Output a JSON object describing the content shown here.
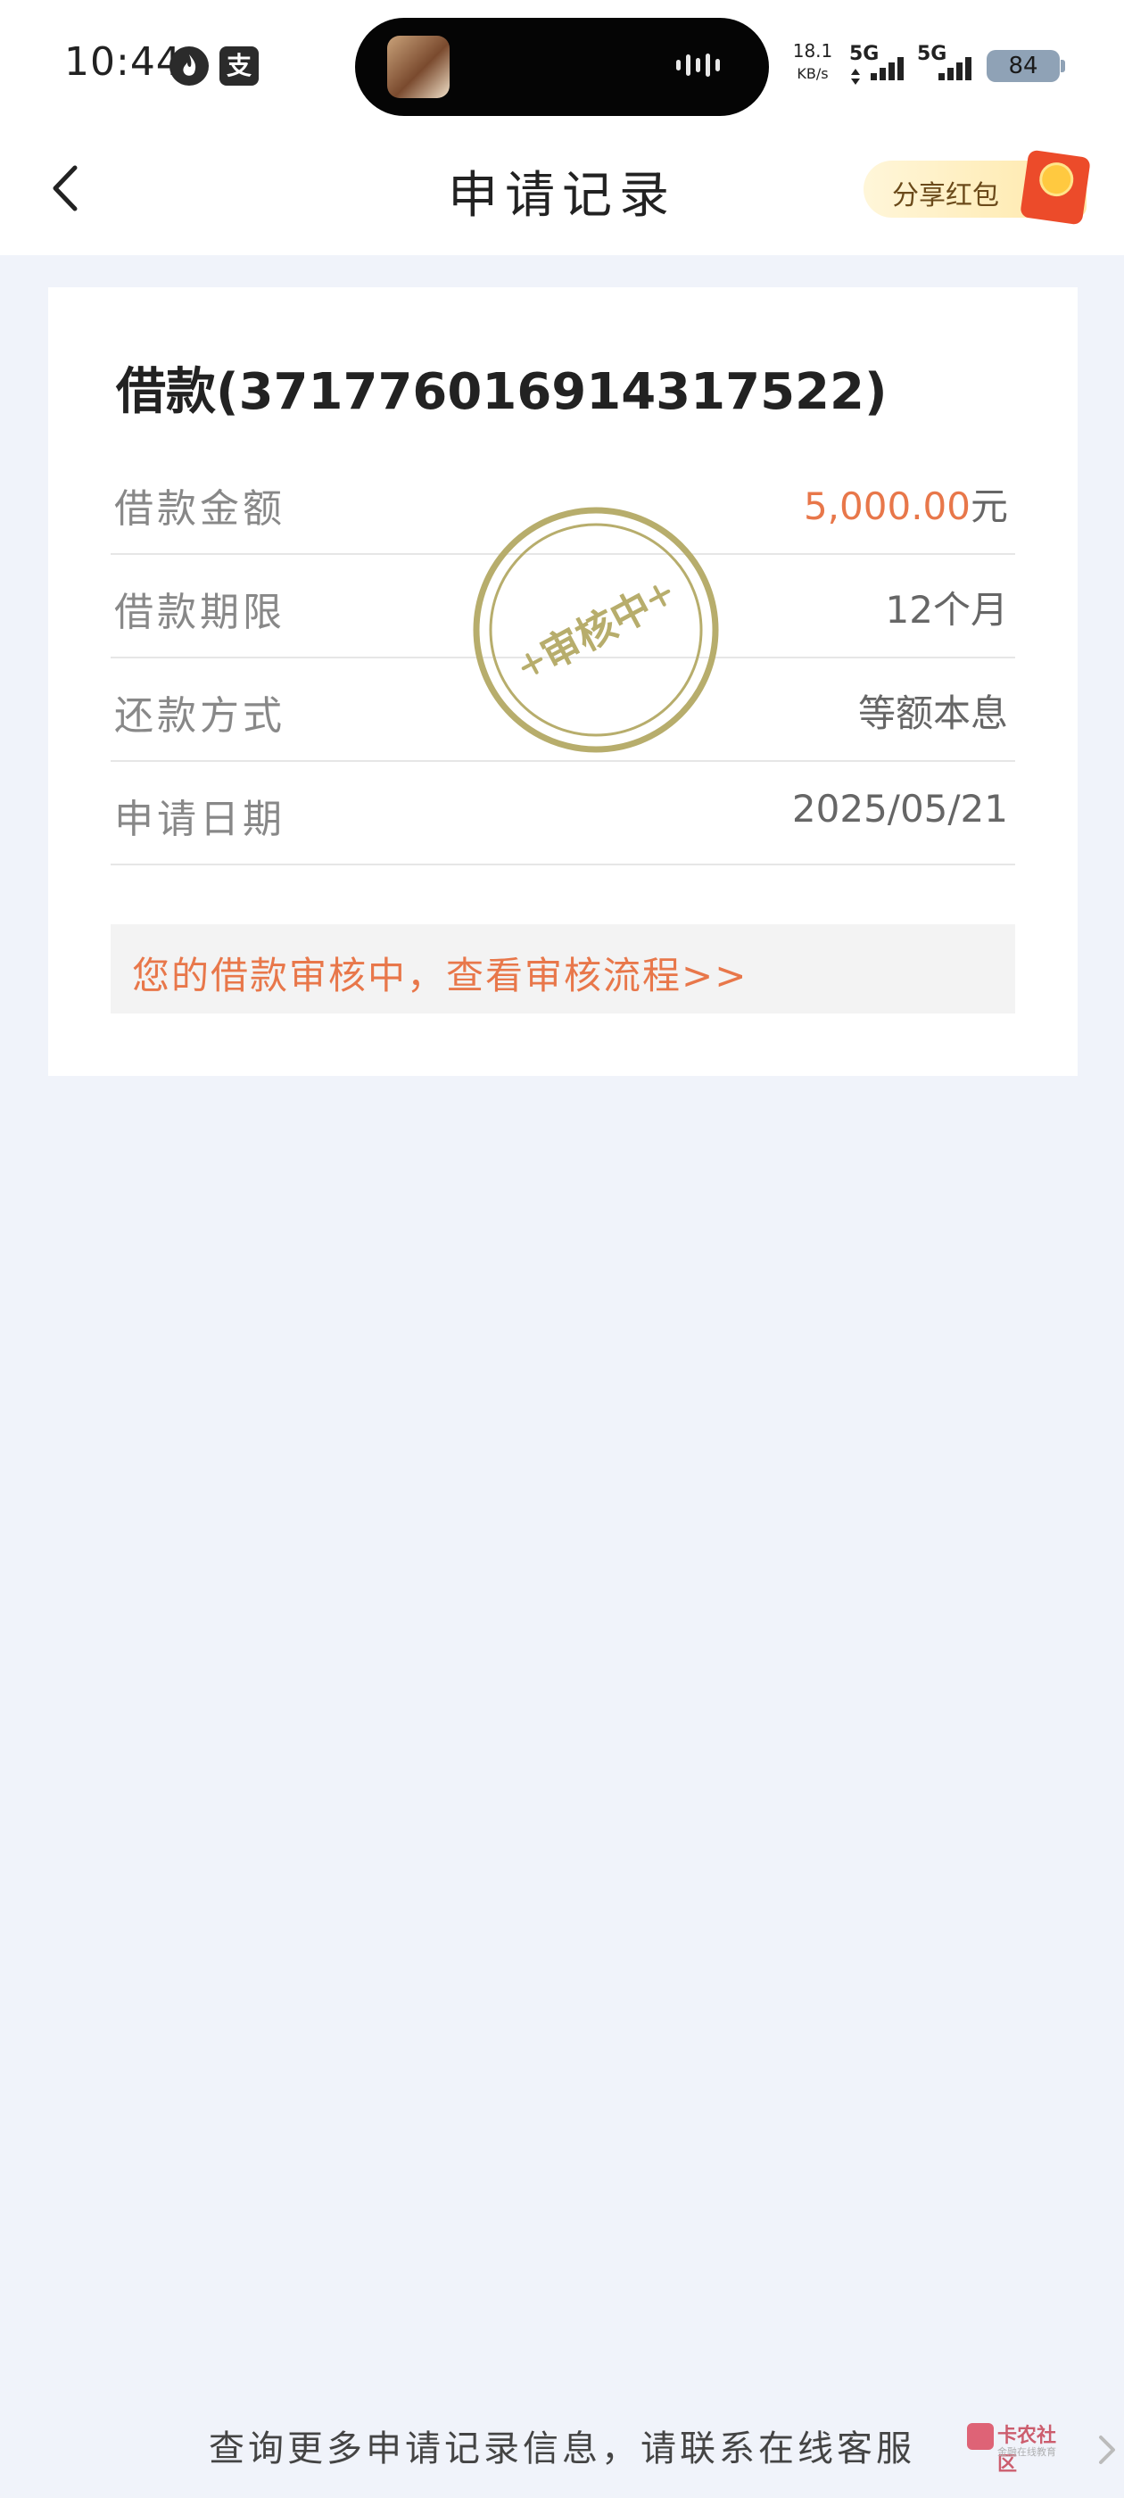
{
  "status_bar": {
    "time": "10:44",
    "net_speed_value": "18.1",
    "net_speed_unit": "KB/s",
    "signal_1_label": "5G",
    "signal_2_label": "5G",
    "battery": "84",
    "alipay_glyph": "支",
    "icons": [
      "flame-app-icon",
      "alipay-icon",
      "signal-icon",
      "battery-icon"
    ]
  },
  "nav": {
    "title": "申请记录",
    "share_label": "分享红包",
    "back_icon": "chevron-left-icon"
  },
  "record": {
    "title": "借款(3717760169143175​22)",
    "rows": [
      {
        "label": "借款金额",
        "value": "5,000.00",
        "unit": "元"
      },
      {
        "label": "借款期限",
        "value": "12个月"
      },
      {
        "label": "还款方式",
        "value": "等额本息"
      },
      {
        "label": "申请日期",
        "value": "2025/05/21"
      }
    ],
    "stamp_text": "审核中",
    "review_notice": "您的借款审核中，查看审核流程>>"
  },
  "footer": {
    "contact_text": "查询更多申请记录信息，请联系在线客服",
    "watermark_name": "卡农社区",
    "watermark_sub": "金融在线教育"
  },
  "colors": {
    "accent_orange": "#e8774a",
    "stamp_olive": "#b7ad6c",
    "page_background": "#f0f3fa"
  }
}
